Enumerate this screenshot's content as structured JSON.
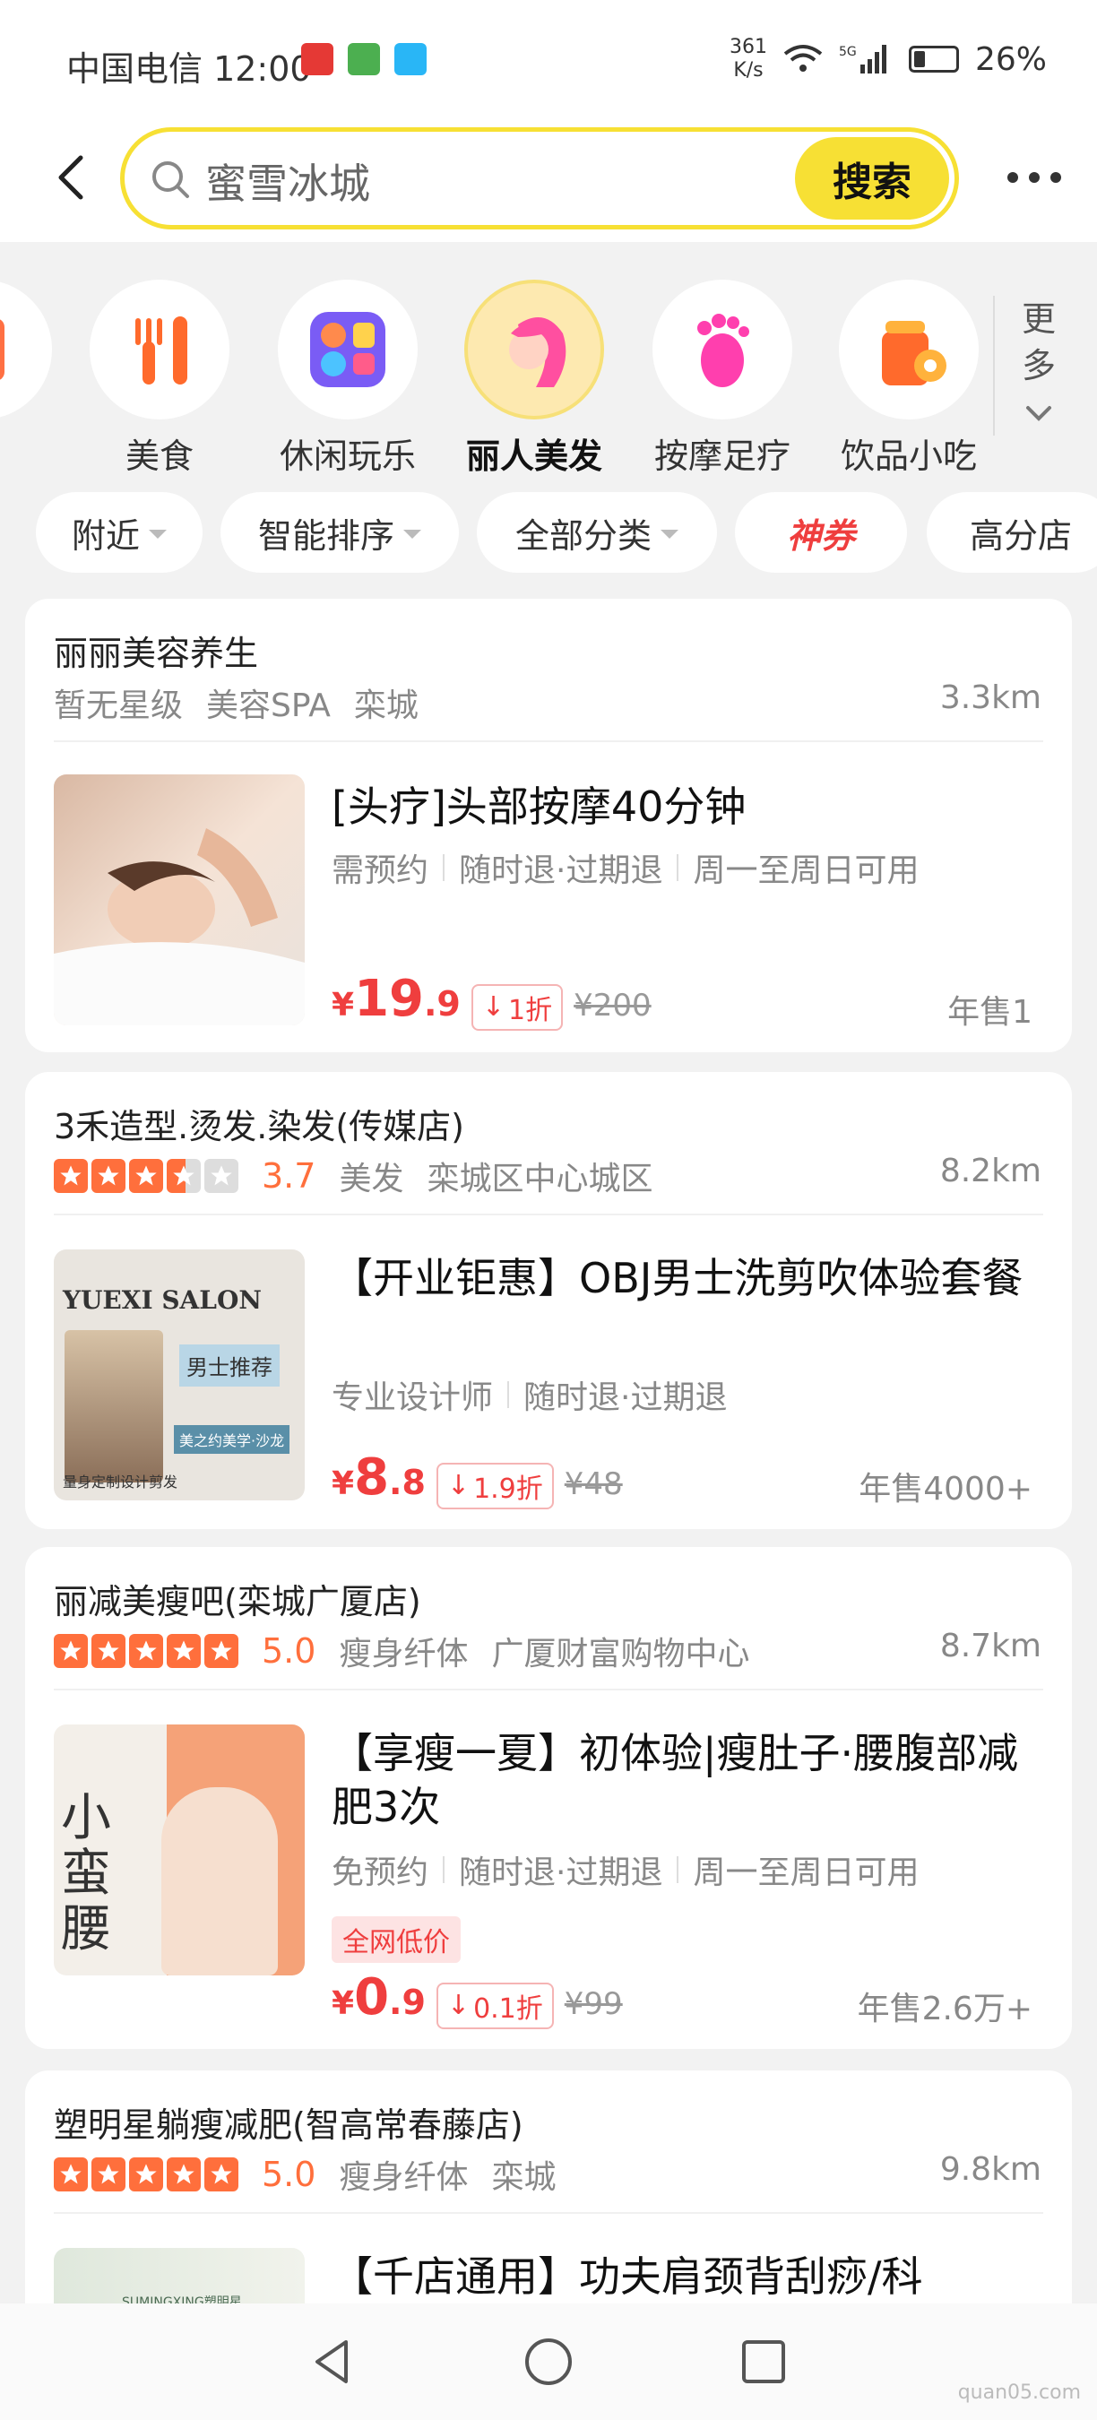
{
  "status": {
    "time": "中国电信 12:00",
    "speed": "361\nK/s",
    "network": "5G",
    "battery": "26%"
  },
  "search": {
    "value": "蜜雪冰城",
    "button": "搜索"
  },
  "categories": [
    {
      "label": "美食"
    },
    {
      "label": "休闲玩乐"
    },
    {
      "label": "丽人美发",
      "active": true
    },
    {
      "label": "按摩足疗"
    },
    {
      "label": "饮品小吃"
    }
  ],
  "more_categories": "更多",
  "filters": [
    "附近",
    "智能排序",
    "全部分类",
    "神券",
    "高分店"
  ],
  "shops": [
    {
      "name": "丽丽美容养生",
      "rating_text": "暂无星级",
      "tags": [
        "美容SPA",
        "栾城"
      ],
      "distance": "3.3km",
      "deal": {
        "title": "[头疗]头部按摩40分钟",
        "tags": [
          "需预约",
          "随时退·过期退",
          "周一至周日可用"
        ],
        "yen": "¥",
        "price_int": "19",
        "price_dec": ".9",
        "discount": "1折",
        "orig": "¥200",
        "sales": "年售1"
      }
    },
    {
      "name": "3禾造型.烫发.染发(传媒店)",
      "rating": "3.7",
      "tags": [
        "美发",
        "栾城区中心城区"
      ],
      "distance": "8.2km",
      "deal": {
        "title": "【开业钜惠】OBJ男士洗剪吹体验套餐",
        "tags": [
          "专业设计师",
          "随时退·过期退"
        ],
        "yen": "¥",
        "price_int": "8",
        "price_dec": ".8",
        "discount": "1.9折",
        "orig": "¥48",
        "sales": "年售4000+",
        "thumb_text": {
          "brand": "YUEXI SALON",
          "recommend": "男士推荐",
          "slogan": "美之约美学·沙龙",
          "footer": "量身定制设计剪发"
        }
      }
    },
    {
      "name": "丽减美瘦吧(栾城广厦店)",
      "rating": "5.0",
      "tags": [
        "瘦身纤体",
        "广厦财富购物中心"
      ],
      "distance": "8.7km",
      "deal": {
        "title": "【享瘦一夏】初体验|瘦肚子·腰腹部减肥3次",
        "tags": [
          "免预约",
          "随时退·过期退",
          "周一至周日可用"
        ],
        "badge": "全网低价",
        "yen": "¥",
        "price_int": "0",
        "price_dec": ".9",
        "discount": "0.1折",
        "orig": "¥99",
        "sales": "年售2.6万+",
        "thumb_text": {
          "big": "小蛮腰"
        }
      }
    },
    {
      "name": "塑明星躺瘦减肥(智高常春藤店)",
      "rating": "5.0",
      "tags": [
        "瘦身纤体",
        "栾城"
      ],
      "distance": "9.8km",
      "deal": {
        "title": "【千店通用】功夫肩颈背刮痧/科",
        "thumb_text": {
          "brand": "SUMINGXING塑明星"
        }
      }
    }
  ],
  "watermark": "quan05.com"
}
